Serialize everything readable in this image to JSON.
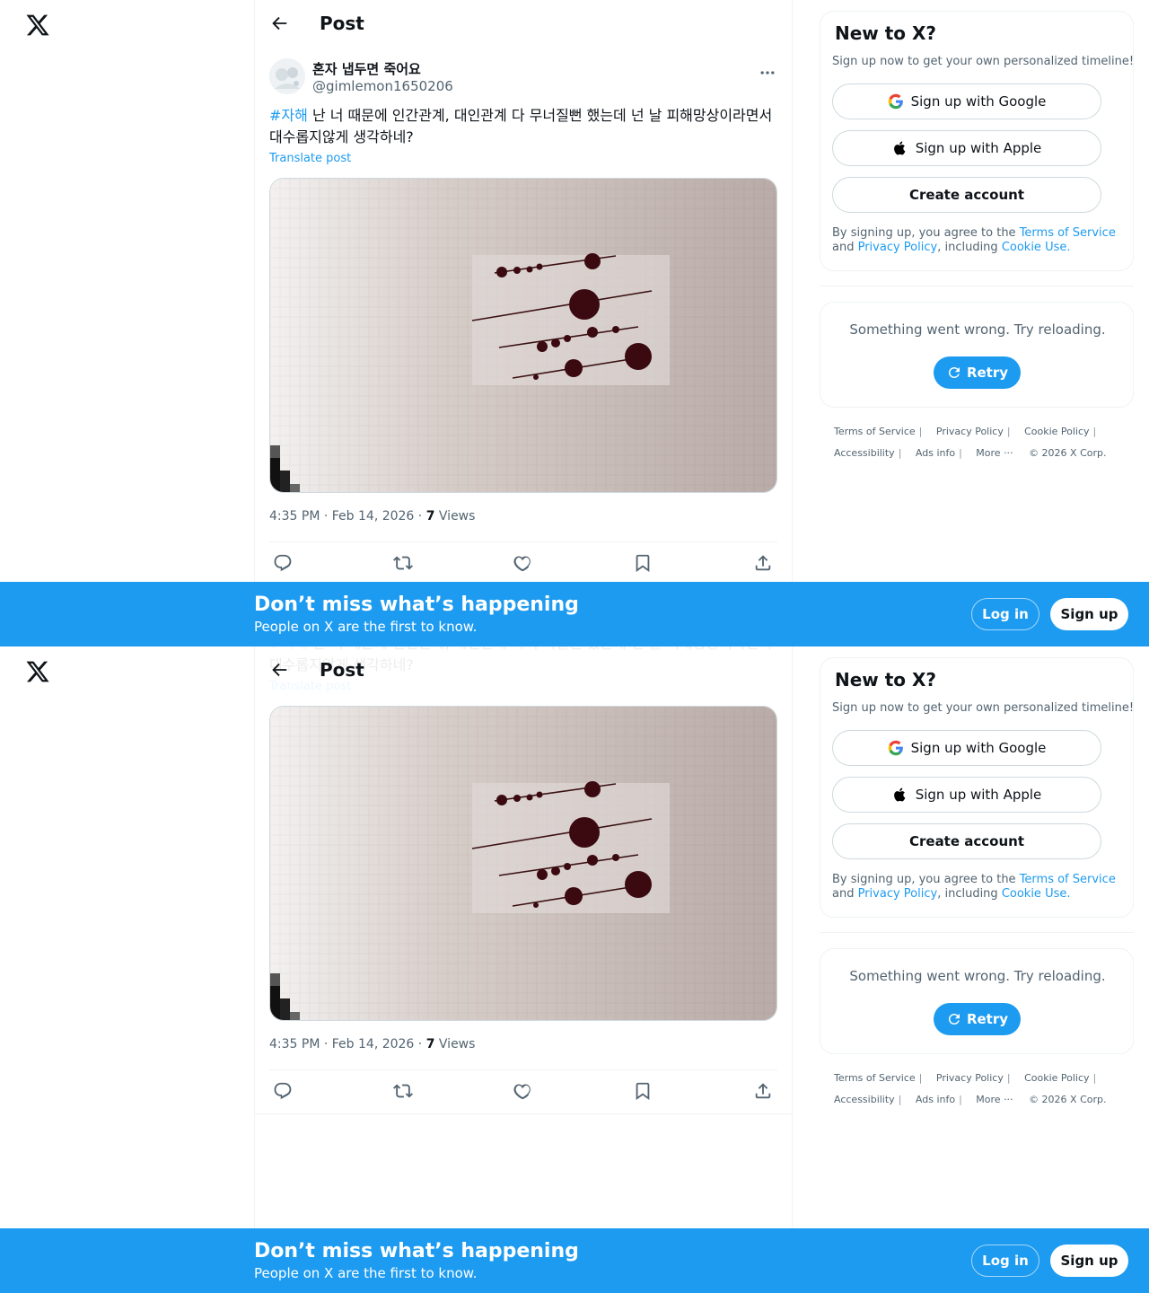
{
  "header": {
    "title": "Post"
  },
  "post": {
    "display_name": "혼자 냅두면 죽어요",
    "handle": "@gimlemon1650206",
    "hashtag": "#자해",
    "text": " 난 너 때문에 인간관계, 대인관계 다 무너질뻔 했는데 넌 날 피해망상이라면서 대수롭지않게 생각하네?",
    "translate": "Translate post",
    "time": "4:35 PM · Feb 14, 2026 · ",
    "views_count": "7",
    "views_label": " Views"
  },
  "sidebar": {
    "title": "New to X?",
    "subtitle": "Sign up now to get your own personalized timeline!",
    "google": "Sign up with Google",
    "apple": "Sign up with Apple",
    "create": "Create account",
    "terms_prefix": "By signing up, you agree to the ",
    "terms_link": "Terms of Service",
    "terms_and": " and ",
    "privacy_link": "Privacy Policy",
    "including": ", including ",
    "cookie_link": "Cookie Use.",
    "error": "Something went wrong. Try reloading.",
    "retry": "Retry",
    "footer_row1": [
      "Terms of Service",
      "Privacy Policy",
      "Cookie Policy"
    ],
    "footer_row2": [
      "Accessibility",
      "Ads info",
      "More ···",
      "© 2026 X Corp."
    ]
  },
  "banner": {
    "title": "Don’t miss what’s happening",
    "subtitle": "People on X are the first to know.",
    "login": "Log in",
    "signup": "Sign up"
  },
  "colors": {
    "accent": "#1d9bf0",
    "text": "#0f1419",
    "muted": "#536471"
  }
}
